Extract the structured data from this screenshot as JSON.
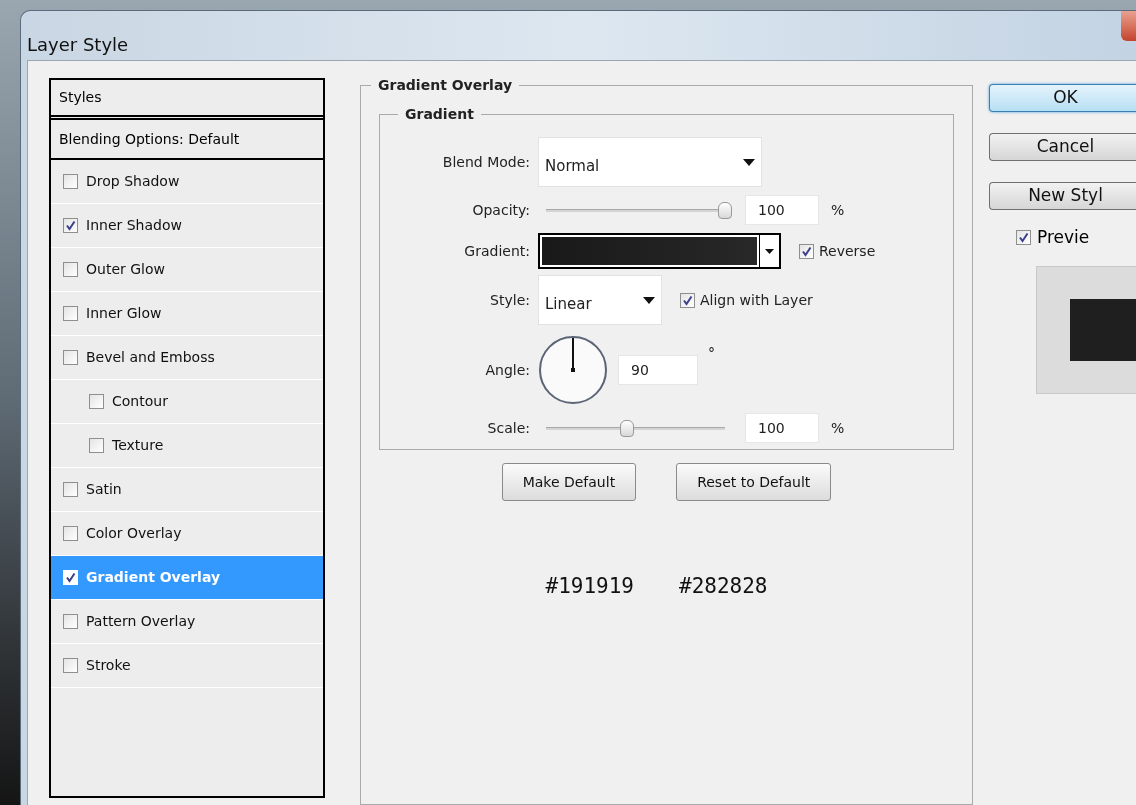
{
  "window": {
    "title": "Layer Style"
  },
  "style_list": {
    "header": "Styles",
    "blending_options": "Blending Options: Default",
    "items": [
      {
        "label": "Drop Shadow",
        "checked": false,
        "selected": false
      },
      {
        "label": "Inner Shadow",
        "checked": true,
        "selected": false
      },
      {
        "label": "Outer Glow",
        "checked": false,
        "selected": false
      },
      {
        "label": "Inner Glow",
        "checked": false,
        "selected": false
      },
      {
        "label": "Bevel and Emboss",
        "checked": false,
        "selected": false,
        "children": [
          {
            "label": "Contour",
            "checked": false,
            "selected": false
          },
          {
            "label": "Texture",
            "checked": false,
            "selected": false
          }
        ]
      },
      {
        "label": "Satin",
        "checked": false,
        "selected": false
      },
      {
        "label": "Color Overlay",
        "checked": false,
        "selected": false
      },
      {
        "label": "Gradient Overlay",
        "checked": true,
        "selected": true
      },
      {
        "label": "Pattern Overlay",
        "checked": false,
        "selected": false
      },
      {
        "label": "Stroke",
        "checked": false,
        "selected": false
      }
    ]
  },
  "gradient_overlay": {
    "title": "Gradient Overlay",
    "gradient": {
      "title": "Gradient",
      "blend_mode": {
        "label": "Blend Mode:",
        "value": "Normal"
      },
      "opacity": {
        "label": "Opacity:",
        "value": "100",
        "unit": "%",
        "level": 1
      },
      "gradient": {
        "label": "Gradient:",
        "reverse": {
          "label": "Reverse",
          "checked": true
        }
      },
      "style": {
        "label": "Style:",
        "value": "Linear",
        "align": {
          "label": "Align with Layer",
          "checked": true
        }
      },
      "angle": {
        "label": "Angle:",
        "value": "90",
        "unit": "°"
      },
      "scale": {
        "label": "Scale:",
        "value": "100",
        "unit": "%",
        "level": 0.45
      }
    },
    "buttons": [
      "Make Default",
      "Reset to Default"
    ],
    "notes": [
      "#191919",
      "#282828"
    ]
  },
  "actions": [
    {
      "label": "OK",
      "kind": "default"
    },
    {
      "label": "Cancel",
      "kind": "normal"
    },
    {
      "label": "New Styl",
      "kind": "normal"
    }
  ],
  "preview": {
    "label": "Previe",
    "checked": true
  }
}
